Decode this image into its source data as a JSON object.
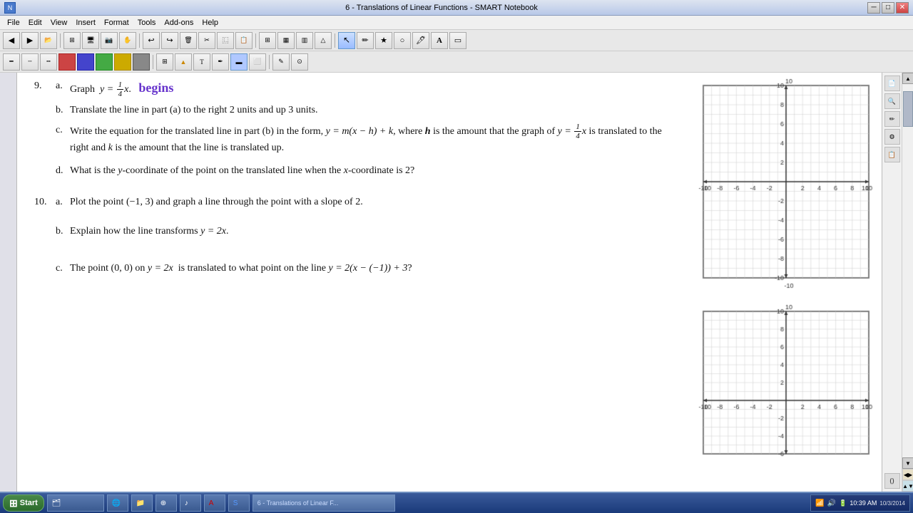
{
  "window": {
    "title": "6 - Translations of Linear Functions - SMART Notebook"
  },
  "menubar": {
    "items": [
      "File",
      "Edit",
      "View",
      "Insert",
      "Format",
      "Tools",
      "Add-ons",
      "Help"
    ]
  },
  "problem9": {
    "number": "9.",
    "part_a": {
      "label": "a.",
      "text": "Graph",
      "equation": "y = (1/4)x",
      "handwriting": "begins"
    },
    "part_b": {
      "label": "b.",
      "text": "Translate the line in part (a) to the right 2 units and up 3 units."
    },
    "part_c": {
      "label": "c.",
      "text1": "Write the equation for the translated line in",
      "text2": "part (b) in the form",
      "equation_form": "y = m(x − h) + k",
      "text3": ", where",
      "h_var": "h",
      "text4": "is the amount that the graph of",
      "equation2": "y = (1/4)x",
      "text5": "is translated to the right and",
      "k_var": "k",
      "text6": "is the amount that the line is translated up."
    },
    "part_d": {
      "label": "d.",
      "text": "What is the y-coordinate of the point on the translated line when the x-coordinate is 2?"
    }
  },
  "problem10": {
    "number": "10.",
    "part_a": {
      "label": "a.",
      "text": "Plot the point (−1, 3) and graph a line through the point with a slope of 2."
    },
    "part_b": {
      "label": "b.",
      "text": "Explain how the line transforms y = 2x."
    },
    "part_c": {
      "label": "c.",
      "text": "The point (0, 0) on y = 2x  is translated to what point on the line y = 2(x − (−1)) + 3?"
    }
  },
  "taskbar": {
    "time": "10:39 AM",
    "date": "10/3/2014",
    "start_label": "Start"
  }
}
